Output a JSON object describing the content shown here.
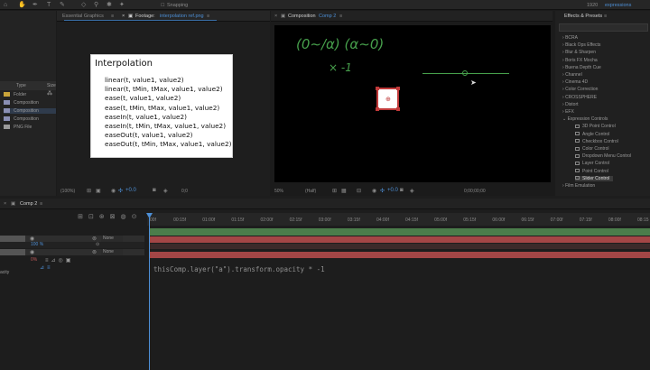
{
  "toolbar": {
    "snapping_label": "Snapping",
    "workspace_number": "1920",
    "workspace_label": "expressions"
  },
  "left_panel": {
    "tab_essential": "Essential Graphics",
    "tab_footage_prefix": "Footage:",
    "tab_footage_file": "interpolation ref.png",
    "col_type": "Type",
    "col_size": "Size",
    "rows": [
      {
        "label": "Folder",
        "color": "#c9a43a"
      },
      {
        "label": "Composition",
        "color": "#8a8fb5"
      },
      {
        "label": "Composition",
        "color": "#8a8fb5"
      },
      {
        "label": "Composition",
        "color": "#8a8fb5"
      },
      {
        "label": "PNG File",
        "color": "#9a9a9a"
      }
    ],
    "zoom": "(100%)"
  },
  "interpolation": {
    "title": "Interpolation",
    "lines": [
      "linear(t, value1, value2)",
      "linear(t, tMin, tMax, value1, value2)",
      "ease(t, value1, value2)",
      "ease(t, tMin, tMax, value1, value2)",
      "easeIn(t, value1, value2)",
      "easeIn(t, tMin, tMax, value1, value2)",
      "easeOut(t, value1, value2)",
      "easeOut(t, tMin, tMax, value1, value2)"
    ]
  },
  "viewer": {
    "tab_prefix": "Composition",
    "tab_comp": "Comp 2",
    "handwriting_1": "(0∼/α) (α∼0)",
    "handwriting_2": "× -1",
    "zoom": "50%",
    "quality": "(Half)",
    "exposure": "+0.0",
    "timecode": "0;00;00;00"
  },
  "effects": {
    "title": "Effects & Presets",
    "categories": [
      "BCRA",
      "Black Ops Effects",
      "Blur & Sharpen",
      "Boris FX Mocha",
      "Buena Depth Cue",
      "Channel",
      "Cinema 4D",
      "Color Correction",
      "CROSSPHERE",
      "Distort",
      "EFX",
      "Expression Controls"
    ],
    "controls": [
      "3D Point Control",
      "Angle Control",
      "Checkbox Control",
      "Color Control",
      "Dropdown Menu Control",
      "Layer Control",
      "Point Control",
      "Slider Control"
    ],
    "footer": "Film Emulation"
  },
  "timeline": {
    "tab": "Comp 2",
    "ruler": [
      "00f",
      "00:15f",
      "01:00f",
      "01:15f",
      "02:00f",
      "02:15f",
      "03:00f",
      "03:15f",
      "04:00f",
      "04:15f",
      "05:00f",
      "05:15f",
      "06:00f",
      "06:15f",
      "07:00f",
      "07:15f",
      "08:00f",
      "08:15"
    ],
    "parent_none_1": "None",
    "parent_none_2": "None",
    "scale_value": "100 %",
    "opacity_value": "0%",
    "property_label": "acity",
    "expression": "thisComp.layer(\"a\").transform.opacity * -1"
  },
  "colors": {
    "accent_blue": "#4d8fd6",
    "track_green": "#4b7d4b",
    "track_red": "#a34646",
    "hand_green": "#47a04c"
  }
}
